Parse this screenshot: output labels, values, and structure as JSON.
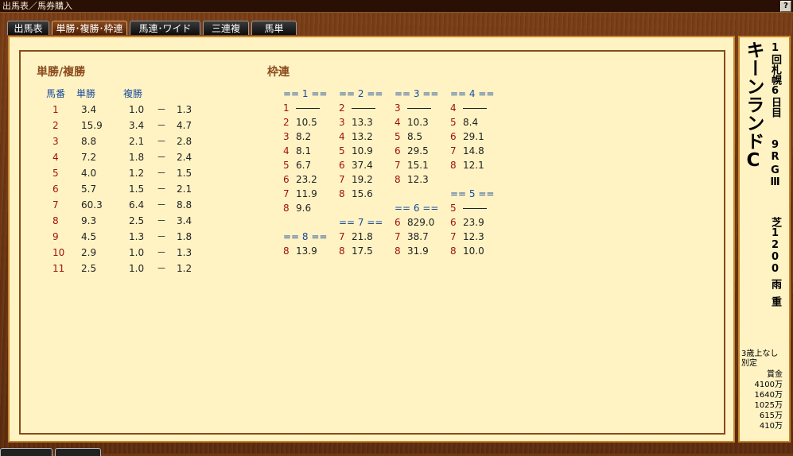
{
  "window": {
    "title": "出馬表／馬券購入",
    "help_label": "?"
  },
  "tabs": [
    {
      "label": "出馬表"
    },
    {
      "label": "単勝･複勝･枠連"
    },
    {
      "label": "馬連･ワイド"
    },
    {
      "label": "三連複"
    },
    {
      "label": "馬単"
    }
  ],
  "win_place": {
    "title": "単勝/複勝",
    "col_headers": [
      "馬番",
      "単勝",
      "複勝"
    ],
    "rows": [
      {
        "num": "1",
        "win": "3.4",
        "place_lo": "1.0",
        "place_hi": "1.3"
      },
      {
        "num": "2",
        "win": "15.9",
        "place_lo": "3.4",
        "place_hi": "4.7"
      },
      {
        "num": "3",
        "win": "8.8",
        "place_lo": "2.1",
        "place_hi": "2.8"
      },
      {
        "num": "4",
        "win": "7.2",
        "place_lo": "1.8",
        "place_hi": "2.4"
      },
      {
        "num": "5",
        "win": "4.0",
        "place_lo": "1.2",
        "place_hi": "1.5"
      },
      {
        "num": "6",
        "win": "5.7",
        "place_lo": "1.5",
        "place_hi": "2.1"
      },
      {
        "num": "7",
        "win": "60.3",
        "place_lo": "6.4",
        "place_hi": "8.8"
      },
      {
        "num": "8",
        "win": "9.3",
        "place_lo": "2.5",
        "place_hi": "3.4"
      },
      {
        "num": "9",
        "win": "4.5",
        "place_lo": "1.3",
        "place_hi": "1.8"
      },
      {
        "num": "10",
        "win": "2.9",
        "place_lo": "1.0",
        "place_hi": "1.3"
      },
      {
        "num": "11",
        "win": "2.5",
        "place_lo": "1.0",
        "place_hi": "1.2"
      }
    ],
    "range_sep": "－"
  },
  "bracket": {
    "title": "枠連",
    "groups": [
      {
        "header": "== 1 ==",
        "rows": [
          {
            "n": "1",
            "v": ""
          },
          {
            "n": "2",
            "v": "10.5"
          },
          {
            "n": "3",
            "v": "8.2"
          },
          {
            "n": "4",
            "v": "8.1"
          },
          {
            "n": "5",
            "v": "6.7"
          },
          {
            "n": "6",
            "v": "23.2"
          },
          {
            "n": "7",
            "v": "11.9"
          },
          {
            "n": "8",
            "v": "9.6"
          }
        ]
      },
      {
        "header": "== 2 ==",
        "rows": [
          {
            "n": "2",
            "v": ""
          },
          {
            "n": "3",
            "v": "13.3"
          },
          {
            "n": "4",
            "v": "13.2"
          },
          {
            "n": "5",
            "v": "10.9"
          },
          {
            "n": "6",
            "v": "37.4"
          },
          {
            "n": "7",
            "v": "19.2"
          },
          {
            "n": "8",
            "v": "15.6"
          }
        ]
      },
      {
        "header": "== 3 ==",
        "rows": [
          {
            "n": "3",
            "v": ""
          },
          {
            "n": "4",
            "v": "10.3"
          },
          {
            "n": "5",
            "v": "8.5"
          },
          {
            "n": "6",
            "v": "29.5"
          },
          {
            "n": "7",
            "v": "15.1"
          },
          {
            "n": "8",
            "v": "12.3"
          }
        ]
      },
      {
        "header": "== 4 ==",
        "rows": [
          {
            "n": "4",
            "v": ""
          },
          {
            "n": "5",
            "v": "8.4"
          },
          {
            "n": "6",
            "v": "29.1"
          },
          {
            "n": "7",
            "v": "14.8"
          },
          {
            "n": "8",
            "v": "12.1"
          }
        ]
      },
      {
        "header": "== 5 ==",
        "rows": [
          {
            "n": "5",
            "v": ""
          },
          {
            "n": "6",
            "v": "23.9"
          },
          {
            "n": "7",
            "v": "12.3"
          },
          {
            "n": "8",
            "v": "10.0"
          }
        ]
      },
      {
        "header": "== 6 ==",
        "rows": [
          {
            "n": "6",
            "v": "829.0"
          },
          {
            "n": "7",
            "v": "38.7"
          },
          {
            "n": "8",
            "v": "31.9"
          }
        ]
      },
      {
        "header": "== 7 ==",
        "rows": [
          {
            "n": "7",
            "v": "21.8"
          },
          {
            "n": "8",
            "v": "17.5"
          }
        ]
      },
      {
        "header": "== 8 ==",
        "rows": [
          {
            "n": "8",
            "v": "13.9"
          }
        ]
      }
    ]
  },
  "race": {
    "name": "キーンランドC",
    "meeting": "1回札幌6日目",
    "race_no": "9R",
    "grade": "GⅢ",
    "surface_distance": "芝1200",
    "weather": "雨",
    "going": "重",
    "conditions": [
      "3歳上なし",
      "別定"
    ],
    "prize_label": "賞金",
    "prizes": [
      "4100万",
      "1640万",
      "1025万",
      "615万",
      "410万"
    ]
  },
  "colors": {
    "accent": "#8a4a1c",
    "panel_bg": "#fff3c4",
    "frame": "#6e3a14",
    "number": "#a31010",
    "header_blue": "#1a4c9c"
  }
}
